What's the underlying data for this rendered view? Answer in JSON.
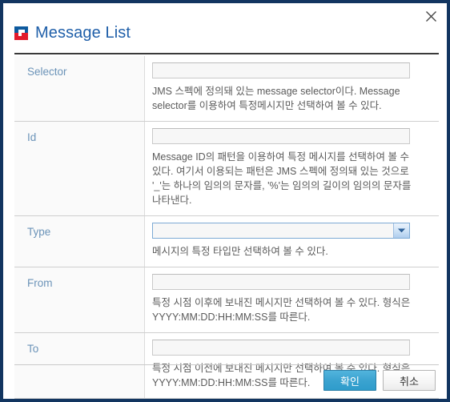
{
  "window": {
    "title": "Message List",
    "close_label": "×",
    "icon": "logo-square-icon",
    "accent_color": "#1f5fa9",
    "frame_color": "#123560",
    "logo_blue": "#0d5a9e",
    "logo_red": "#e21b2c"
  },
  "form": {
    "rows": [
      {
        "label": "Selector",
        "control": "text",
        "value": "",
        "placeholder": "",
        "help": "JMS 스펙에 정의돼 있는 message selector이다. Message selector를 이용하여 특정메시지만 선택하여 볼 수 있다."
      },
      {
        "label": "Id",
        "control": "text",
        "value": "",
        "placeholder": "",
        "help": "Message ID의 패턴을 이용하여 특정 메시지를 선택하여 볼 수 있다. 여기서 이용되는 패턴은 JMS 스펙에 정의돼 있는 것으로 '_'는 하나의 임의의 문자를, '%'는 임의의 길이의 임의의 문자를 나타낸다."
      },
      {
        "label": "Type",
        "control": "select",
        "value": "",
        "options": [
          ""
        ],
        "help": "메시지의 특정 타입만 선택하여 볼 수 있다."
      },
      {
        "label": "From",
        "control": "text",
        "value": "",
        "placeholder": "",
        "help": "특정 시점 이후에 보내진 메시지만 선택하여 볼 수 있다. 형식은 YYYY:MM:DD:HH:MM:SS를 따른다."
      },
      {
        "label": "To",
        "control": "text",
        "value": "",
        "placeholder": "",
        "help": "특정 시점 이전에 보내진 메시지만 선택하여 볼 수 있다. 형식은 YYYY:MM:DD:HH:MM:SS를 따른다."
      }
    ]
  },
  "footer": {
    "confirm_label": "확인",
    "cancel_label": "취소",
    "confirm_color": "#3ba3d0"
  }
}
